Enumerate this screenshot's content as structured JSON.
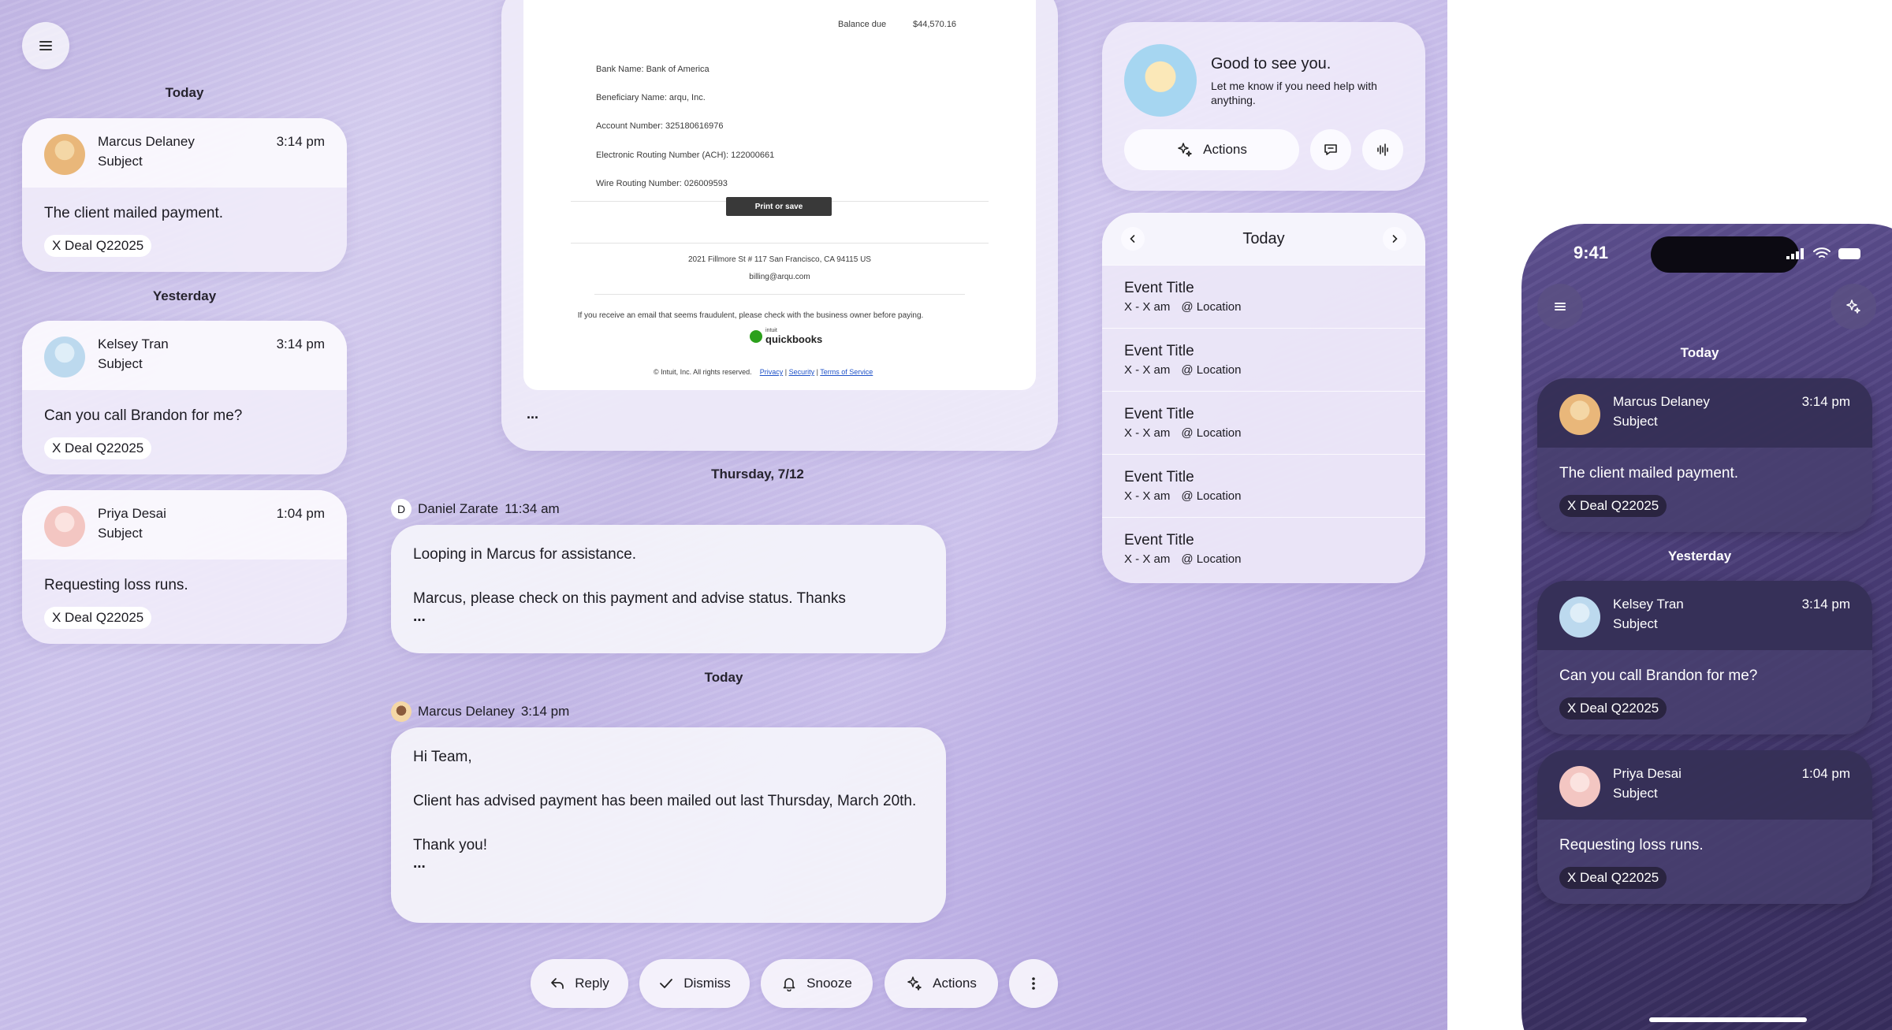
{
  "left_feed": {
    "today_label": "Today",
    "yesterday_label": "Yesterday",
    "items": [
      {
        "name": "Marcus Delaney",
        "subject": "Subject",
        "time": "3:14 pm",
        "message": "The client mailed payment.",
        "tag": "X Deal Q22025"
      },
      {
        "name": "Kelsey Tran",
        "subject": "Subject",
        "time": "3:14 pm",
        "message": "Can you call Brandon for me?",
        "tag": "X Deal Q22025"
      },
      {
        "name": "Priya Desai",
        "subject": "Subject",
        "time": "1:04 pm",
        "message": "Requesting loss runs.",
        "tag": "X Deal Q22025"
      }
    ]
  },
  "invoice": {
    "balance_label": "Balance due",
    "balance_value": "$44,570.16",
    "bank_name": "Bank Name: Bank of America",
    "beneficiary": "Beneficiary Name: arqu, Inc.",
    "account": "Account Number: 325180616976",
    "ach": "Electronic Routing Number (ACH): 122000661",
    "wire": "Wire Routing Number: 026009593",
    "print_label": "Print or save",
    "address": "2021 Fillmore St # 117 San Francisco, CA 94115 US",
    "email": "billing@arqu.com",
    "fraud_note": "If you receive an email that seems fraudulent, please check with the business owner before paying.",
    "logo_small": "intuit",
    "logo_text": "quickbooks",
    "copyright": "© Intuit, Inc. All rights reserved.",
    "privacy": "Privacy",
    "security": "Security",
    "terms": "Terms of Service",
    "more": "..."
  },
  "thread": {
    "date1": "Thursday, 7/12",
    "msg1": {
      "initial": "D",
      "author": "Daniel Zarate",
      "time": "11:34 am",
      "lines": [
        "Looping in Marcus for assistance.",
        "Marcus, please check on this payment and advise status. Thanks"
      ],
      "more": "..."
    },
    "date2": "Today",
    "msg2": {
      "author": "Marcus Delaney",
      "time": "3:14 pm",
      "lines": [
        "Hi Team,",
        "Client has advised payment has been mailed out last Thursday, March 20th.",
        "Thank you!"
      ],
      "more": "..."
    }
  },
  "action_bar": {
    "reply": "Reply",
    "dismiss": "Dismiss",
    "snooze": "Snooze",
    "actions": "Actions"
  },
  "assistant": {
    "greeting": "Good to see you.",
    "subtext": "Let me know if you need help with anything.",
    "actions_label": "Actions"
  },
  "calendar": {
    "title": "Today",
    "events": [
      {
        "title": "Event Title",
        "time": "X - X am",
        "location": "@ Location"
      },
      {
        "title": "Event Title",
        "time": "X - X am",
        "location": "@ Location"
      },
      {
        "title": "Event Title",
        "time": "X - X am",
        "location": "@ Location"
      },
      {
        "title": "Event Title",
        "time": "X - X am",
        "location": "@ Location"
      },
      {
        "title": "Event Title",
        "time": "X - X am",
        "location": "@ Location"
      }
    ]
  },
  "phone": {
    "clock": "9:41",
    "today_label": "Today",
    "yesterday_label": "Yesterday",
    "items": [
      {
        "name": "Marcus Delaney",
        "subject": "Subject",
        "time": "3:14 pm",
        "message": "The client mailed payment.",
        "tag": "X Deal Q22025"
      },
      {
        "name": "Kelsey Tran",
        "subject": "Subject",
        "time": "3:14 pm",
        "message": "Can you call Brandon for me?",
        "tag": "X Deal Q22025"
      },
      {
        "name": "Priya Desai",
        "subject": "Subject",
        "time": "1:04 pm",
        "message": "Requesting loss runs.",
        "tag": "X Deal Q22025"
      }
    ]
  },
  "colors": {
    "background": "#c6bbe7",
    "phone_background": "#463a74",
    "accent_green": "#2ca01c",
    "link_blue": "#1f52c8"
  }
}
